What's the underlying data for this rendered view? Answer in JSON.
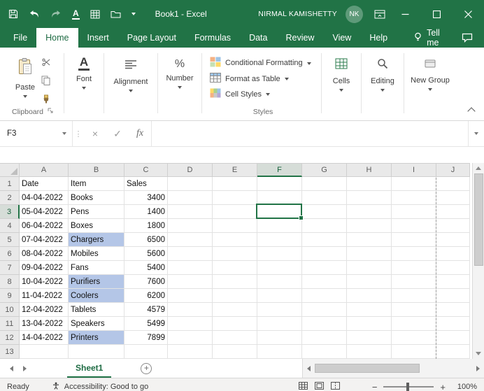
{
  "colors": {
    "excel_green": "#217346",
    "selection_border": "#217346",
    "cell_highlight": "#B4C6E7",
    "header_selected_bg": "#D6DDD8"
  },
  "icons": {
    "font_a": "A",
    "percent": "%",
    "cross": "×",
    "check": "✓",
    "dots": "⋮",
    "plus": "+",
    "minus": "−"
  },
  "title_bar": {
    "workbook_title": "Book1  -  Excel",
    "user_name": "NIRMAL KAMISHETTY",
    "user_initials": "NK"
  },
  "tabs": [
    "File",
    "Home",
    "Insert",
    "Page Layout",
    "Formulas",
    "Data",
    "Review",
    "View",
    "Help"
  ],
  "selected_tab": "Home",
  "tell_me_label": "Tell me",
  "ribbon": {
    "paste_label": "Paste",
    "clipboard_group": "Clipboard",
    "font_group": "Font",
    "alignment_group": "Alignment",
    "number_group": "Number",
    "conditional_formatting": "Conditional Formatting",
    "format_as_table": "Format as Table",
    "cell_styles": "Cell Styles",
    "styles_group": "Styles",
    "cells_group": "Cells",
    "editing_group": "Editing",
    "new_group": "New Group"
  },
  "formula_bar": {
    "name_box_value": "F3",
    "fx_label": "fx",
    "formula_value": ""
  },
  "grid": {
    "column_headers": [
      "A",
      "B",
      "C",
      "D",
      "E",
      "F",
      "G",
      "H",
      "I",
      "J"
    ],
    "selected_cell": "F3",
    "selected_column": "F",
    "selected_row": 3,
    "page_break_after_column": "I",
    "highlighted_cells": [
      "B5",
      "B8",
      "B9",
      "B12"
    ],
    "rows": [
      {
        "n": 1,
        "A": "Date",
        "B": "Item",
        "C": "Sales"
      },
      {
        "n": 2,
        "A": "04-04-2022",
        "B": "Books",
        "C": "3400"
      },
      {
        "n": 3,
        "A": "05-04-2022",
        "B": "Pens",
        "C": "1400"
      },
      {
        "n": 4,
        "A": "06-04-2022",
        "B": "Boxes",
        "C": "1800"
      },
      {
        "n": 5,
        "A": "07-04-2022",
        "B": "Chargers",
        "C": "6500"
      },
      {
        "n": 6,
        "A": "08-04-2022",
        "B": "Mobiles",
        "C": "5600"
      },
      {
        "n": 7,
        "A": "09-04-2022",
        "B": "Fans",
        "C": "5400"
      },
      {
        "n": 8,
        "A": "10-04-2022",
        "B": "Purifiers",
        "C": "7600"
      },
      {
        "n": 9,
        "A": "11-04-2022",
        "B": "Coolers",
        "C": "6200"
      },
      {
        "n": 10,
        "A": "12-04-2022",
        "B": "Tablets",
        "C": "4579"
      },
      {
        "n": 11,
        "A": "13-04-2022",
        "B": "Speakers",
        "C": "5499"
      },
      {
        "n": 12,
        "A": "14-04-2022",
        "B": "Printers",
        "C": "7899"
      },
      {
        "n": 13,
        "A": "",
        "B": "",
        "C": ""
      }
    ]
  },
  "sheet_bar": {
    "active_sheet": "Sheet1"
  },
  "status_bar": {
    "mode": "Ready",
    "accessibility": "Accessibility: Good to go",
    "zoom_level": "100%"
  }
}
